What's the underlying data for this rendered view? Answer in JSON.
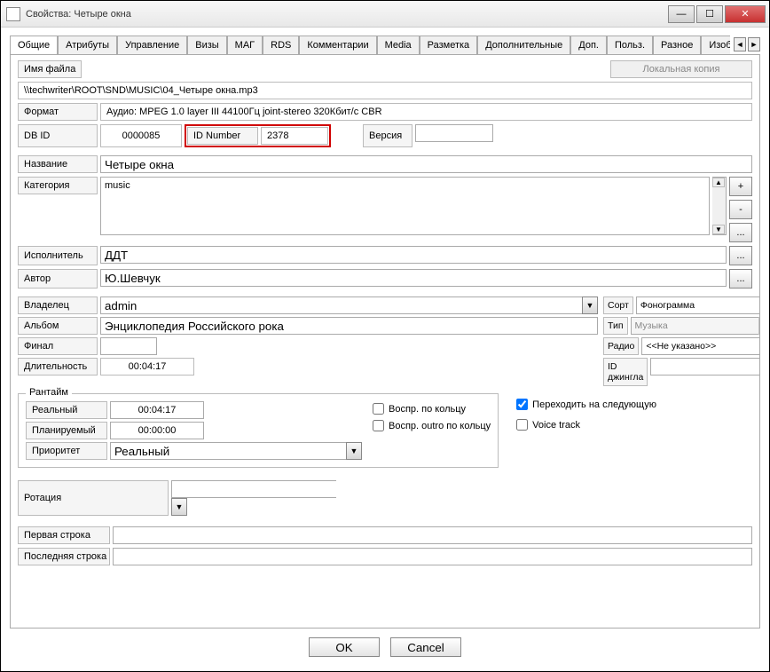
{
  "window": {
    "title": "Свойства: Четыре окна"
  },
  "tabs": [
    "Общие",
    "Атрибуты",
    "Управление",
    "Визы",
    "МАГ",
    "RDS",
    "Комментарии",
    "Media",
    "Разметка",
    "Дополнительные",
    "Доп.",
    "Польз.",
    "Разное",
    "Изображени"
  ],
  "active_tab": 0,
  "file": {
    "filename_label": "Имя файла",
    "local_copy_btn": "Локальная копия",
    "path": "\\\\techwriter\\ROOT\\SND\\MUSIC\\04_Четыре окна.mp3"
  },
  "format": {
    "label": "Формат",
    "value": "Аудио: MPEG 1.0 layer III 44100Гц joint-stereo 320Кбит/с CBR"
  },
  "dbid": {
    "label": "DB ID",
    "value": "0000085"
  },
  "idnumber": {
    "label": "ID Number",
    "value": "2378"
  },
  "version": {
    "label": "Версия",
    "value": ""
  },
  "name": {
    "label": "Название",
    "value": "Четыре окна"
  },
  "category": {
    "label": "Категория",
    "value": "music"
  },
  "cat_btns": {
    "add": "+",
    "remove": "-",
    "more": "..."
  },
  "performer": {
    "label": "Исполнитель",
    "value": "ДДТ"
  },
  "author": {
    "label": "Автор",
    "value": "Ю.Шевчук"
  },
  "owner": {
    "label": "Владелец",
    "value": "admin"
  },
  "album": {
    "label": "Альбом",
    "value": "Энциклопедия Российского рока"
  },
  "final": {
    "label": "Финал",
    "value": ""
  },
  "duration": {
    "label": "Длительность",
    "value": "00:04:17"
  },
  "right": {
    "sort": {
      "label": "Сорт",
      "value": "Фонограмма"
    },
    "type": {
      "label": "Тип",
      "value": "Музыка"
    },
    "radio": {
      "label": "Радио",
      "value": "<<Не указано>>"
    },
    "jingle": {
      "label": "ID джингла",
      "value": ""
    }
  },
  "runtime": {
    "legend": "Рантайм",
    "real": {
      "label": "Реальный",
      "value": "00:04:17"
    },
    "planned": {
      "label": "Планируемый",
      "value": "00:00:00"
    },
    "priority": {
      "label": "Приоритет",
      "value": "Реальный"
    },
    "loop": "Воспр. по кольцу",
    "outro_loop": "Воспр. outro по кольцу",
    "next": "Переходить на следующую",
    "voice": "Voice track"
  },
  "rotation": {
    "label": "Ротация",
    "value": ""
  },
  "line1": {
    "label": "Первая строка",
    "value": ""
  },
  "line2": {
    "label": "Последняя строка",
    "value": ""
  },
  "footer": {
    "ok": "OK",
    "cancel": "Cancel"
  }
}
